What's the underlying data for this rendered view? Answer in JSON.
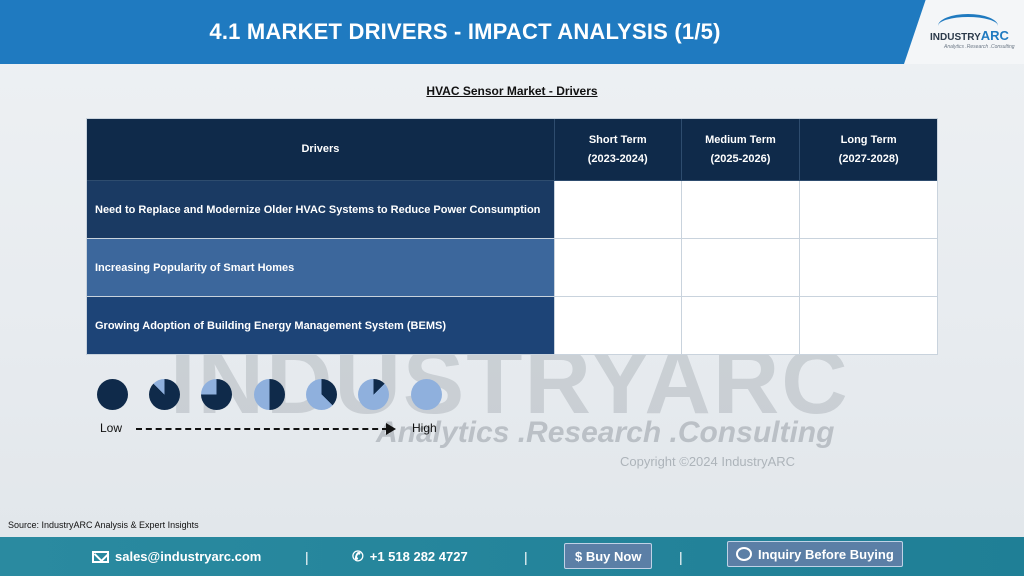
{
  "header": {
    "title": "4.1 MARKET DRIVERS - IMPACT ANALYSIS (1/5)",
    "logo_text_main": "INDUSTRY",
    "logo_text_arc": "ARC",
    "logo_tagline": "Analytics .Research .Consulting"
  },
  "watermark": {
    "brand": "INDUSTRYARC",
    "tagline": "Analytics .Research .Consulting",
    "copyright": "Copyright ©2024 IndustryARC"
  },
  "subtitle": "HVAC Sensor Market - Drivers",
  "table": {
    "header": {
      "drivers": "Drivers",
      "short_term": "Short Term",
      "short_term_years": "(2023-2024)",
      "medium_term": "Medium Term",
      "medium_term_years": "(2025-2026)",
      "long_term": "Long Term",
      "long_term_years": "(2027-2028)"
    },
    "rows": [
      {
        "driver": "Need to Replace and Modernize Older HVAC Systems to Reduce Power Consumption"
      },
      {
        "driver": "Increasing Popularity of Smart Homes"
      },
      {
        "driver": "Growing Adoption of Building Energy Management System (BEMS)"
      }
    ]
  },
  "legend": {
    "low": "Low",
    "high": "High",
    "dark_color": "#0f2a4a",
    "light_color": "#8fb0dd",
    "pies": [
      {
        "dark_fraction": 1.0
      },
      {
        "dark_fraction": 0.875
      },
      {
        "dark_fraction": 0.75
      },
      {
        "dark_fraction": 0.5
      },
      {
        "dark_fraction": 0.375
      },
      {
        "dark_fraction": 0.125
      },
      {
        "dark_fraction": 0.0
      }
    ]
  },
  "source": "Source: IndustryARC Analysis & Expert Insights",
  "footer": {
    "email": "sales@industryarc.com",
    "phone": "+1 518 282 4727",
    "buy_now": "$ Buy Now",
    "inquiry": "Inquiry Before Buying",
    "separator": "|"
  }
}
